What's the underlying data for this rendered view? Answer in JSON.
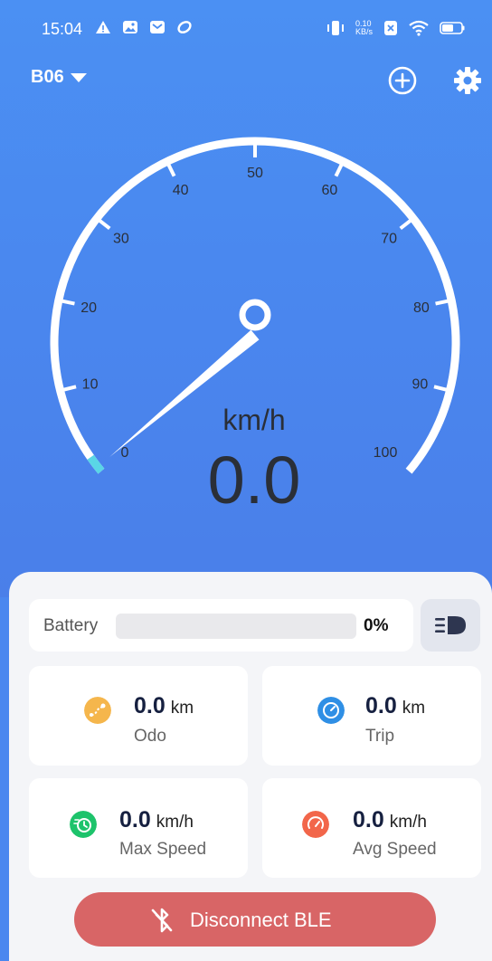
{
  "status_bar": {
    "time": "15:04",
    "net_speed_value": "0.10",
    "net_speed_unit": "KB/s",
    "icons": [
      "alert-icon",
      "photo-icon",
      "mail-icon",
      "sync-icon",
      "vibrate-icon",
      "sim-x-icon",
      "wifi-icon",
      "battery-icon"
    ]
  },
  "header": {
    "device_name": "B06",
    "add_icon": "plus-circle-icon",
    "settings_icon": "gear-icon"
  },
  "gauge": {
    "tick_labels": [
      "0",
      "10",
      "20",
      "30",
      "40",
      "50",
      "60",
      "70",
      "80",
      "90",
      "100"
    ],
    "unit": "km/h",
    "speed": "0.0",
    "speed_value": 0,
    "max": 100
  },
  "battery": {
    "label": "Battery",
    "percent": "0%",
    "level": 0,
    "light_icon": "headlight-icon"
  },
  "stats": {
    "odo": {
      "value": "0.0",
      "unit": "km",
      "label": "Odo",
      "icon": "route-icon",
      "color": "#f5b64c"
    },
    "trip": {
      "value": "0.0",
      "unit": "km",
      "label": "Trip",
      "icon": "gauge-icon",
      "color": "#2f8fe5"
    },
    "max_speed": {
      "value": "0.0",
      "unit": "km/h",
      "label": "Max Speed",
      "icon": "timer-icon",
      "color": "#1dc36b"
    },
    "avg_speed": {
      "value": "0.0",
      "unit": "km/h",
      "label": "Avg Speed",
      "icon": "speedometer-icon",
      "color": "#f2664a"
    }
  },
  "actions": {
    "disconnect_label": "Disconnect BLE",
    "disconnect_icon": "bluetooth-off-icon"
  },
  "colors": {
    "background": "#4a87ef",
    "panel": "#f4f5f8",
    "disconnect": "#d86566",
    "gauge_accent": "#5ad6e6"
  }
}
